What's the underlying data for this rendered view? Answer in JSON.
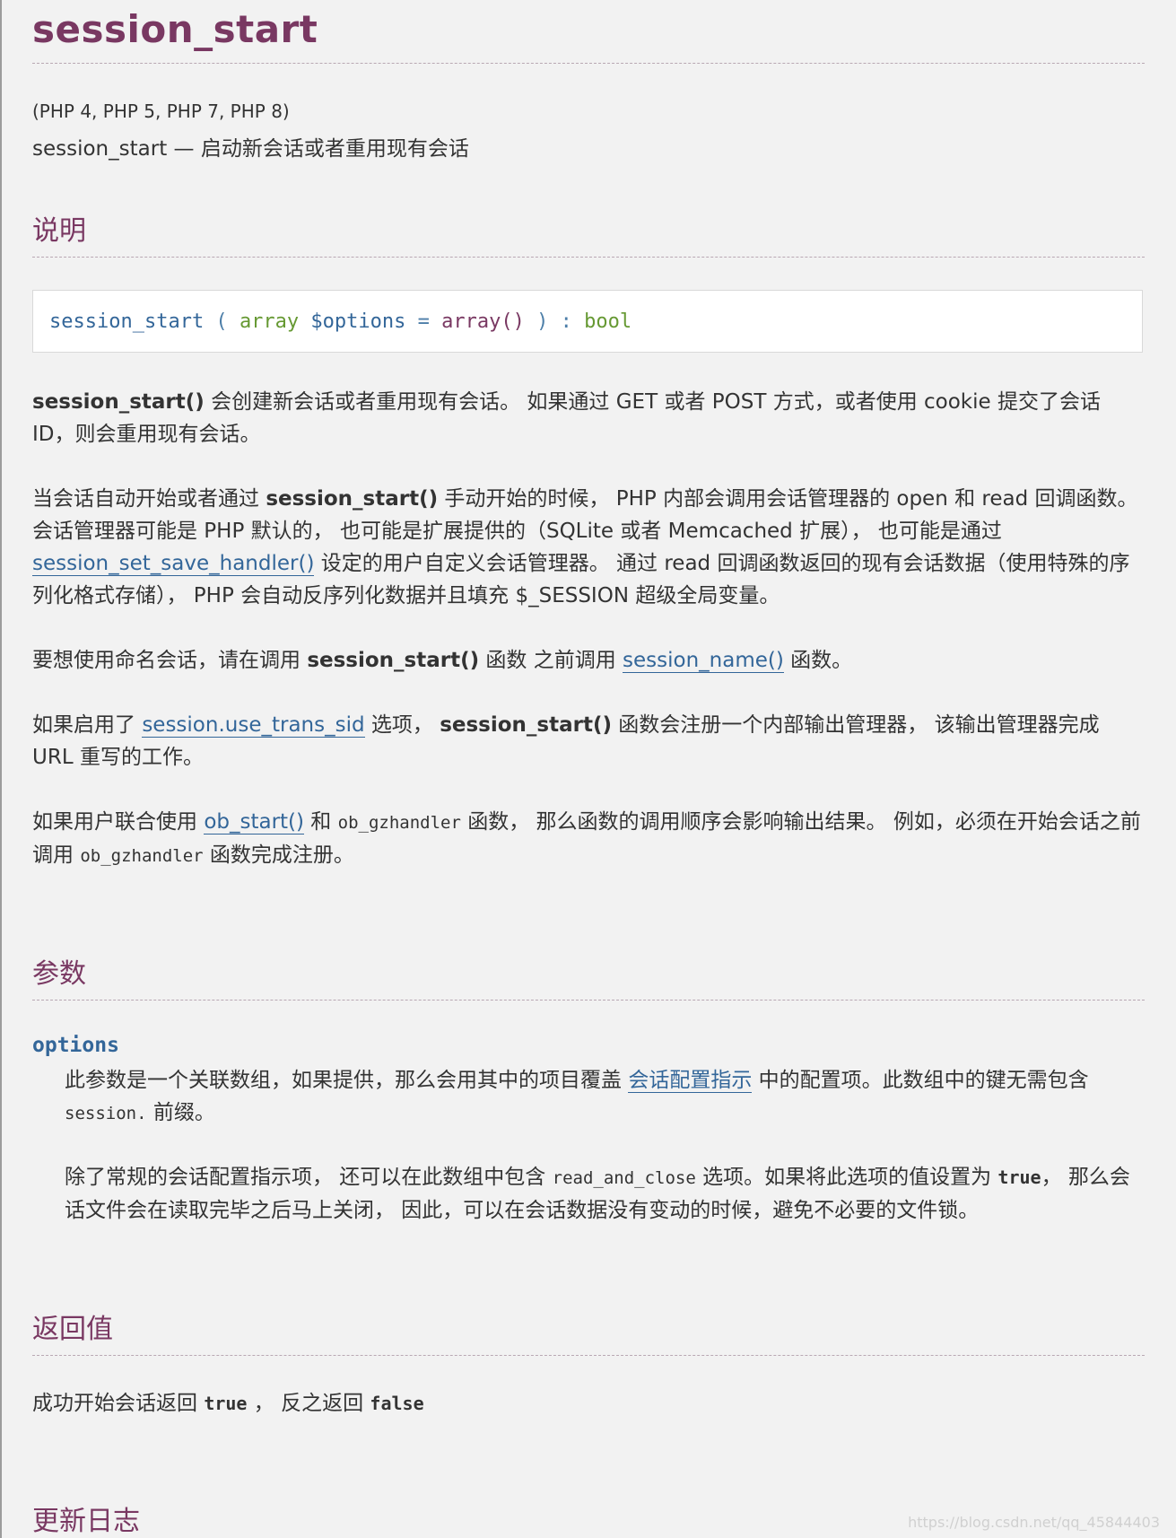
{
  "title": "session_start",
  "versions": "(PHP 4, PHP 5, PHP 7, PHP 8)",
  "refpurpose": "session_start — 启动新会话或者重用现有会话",
  "sections": {
    "description": "说明",
    "parameters": "参数",
    "returnvalues": "返回值",
    "changelog": "更新日志"
  },
  "synopsis": {
    "method": "session_start",
    "open": " ( ",
    "type": "array",
    "param": "$options",
    "eq": " = ",
    "default": "array()",
    "close": " ) : ",
    "return_type": "bool"
  },
  "p1": {
    "func": "session_start()",
    "text1": " 会创建新会话或者重用现有会话。 如果通过 GET 或者 POST 方式，或者使用 cookie 提交了会话 ID，则会重用现有会话。"
  },
  "p2": {
    "text1": "当会话自动开始或者通过 ",
    "func": "session_start()",
    "text2": " 手动开始的时候， PHP 内部会调用会话管理器的 open 和 read 回调函数。 会话管理器可能是 PHP 默认的， 也可能是扩展提供的（SQLite 或者 Memcached 扩展）， 也可能是通过 ",
    "link": "session_set_save_handler()",
    "text3": " 设定的用户自定义会话管理器。 通过 read 回调函数返回的现有会话数据（使用特殊的序列化格式存储）， PHP 会自动反序列化数据并且填充 $_SESSION 超级全局变量。"
  },
  "p3": {
    "text1": "要想使用命名会话，请在调用 ",
    "func": "session_start()",
    "text2": " 函数 之前调用 ",
    "link": "session_name()",
    "text3": " 函数。"
  },
  "p4": {
    "text1": "如果启用了 ",
    "link": "session.use_trans_sid",
    "text2": " 选项， ",
    "func": "session_start()",
    "text3": " 函数会注册一个内部输出管理器， 该输出管理器完成 URL 重写的工作。"
  },
  "p5": {
    "text1": "如果用户联合使用 ",
    "link": "ob_start()",
    "text2": " 和 ",
    "code1": "ob_gzhandler",
    "text3": " 函数， 那么函数的调用顺序会影响输出结果。 例如，必须在开始会话之前调用 ",
    "code2": "ob_gzhandler",
    "text4": " 函数完成注册。"
  },
  "param": {
    "name": "options",
    "d1_text1": "此参数是一个关联数组，如果提供，那么会用其中的项目覆盖 ",
    "d1_link": "会话配置指示",
    "d1_text2": " 中的配置项。此数组中的键无需包含 ",
    "d1_code": "session.",
    "d1_text3": " 前缀。",
    "d2_text1": "除了常规的会话配置指示项， 还可以在此数组中包含 ",
    "d2_code": "read_and_close",
    "d2_text2": " 选项。如果将此选项的值设置为 ",
    "d2_bold": "true",
    "d2_text3": "， 那么会话文件会在读取完毕之后马上关闭， 因此，可以在会话数据没有变动的时候，避免不必要的文件锁。"
  },
  "returns": {
    "text1": "成功开始会话返回 ",
    "true": "true",
    "text2": " ， 反之返回 ",
    "false": "false"
  },
  "watermark": "https://blog.csdn.net/qq_45844403"
}
